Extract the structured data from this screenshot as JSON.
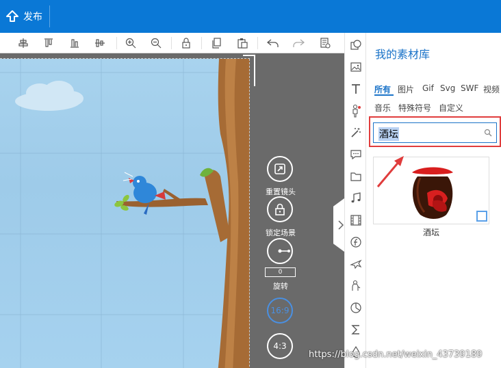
{
  "topbar": {
    "publish_label": "发布"
  },
  "toolbar": {
    "icons": [
      "align-center-icon",
      "align-top-icon",
      "align-bottom-icon",
      "align-middle-icon",
      "zoom-in-icon",
      "zoom-out-icon",
      "lock-icon",
      "copy-icon",
      "paste-icon",
      "undo-icon",
      "redo-icon",
      "properties-icon"
    ]
  },
  "camera": {
    "reset_label": "重置镜头",
    "lock_label": "锁定场景",
    "rotate_label": "旋转",
    "rotate_value": "0",
    "ratio_169": "16:9",
    "ratio_43": "4:3"
  },
  "sidebar_icons": [
    "shape-icon",
    "image-icon",
    "text-icon",
    "character-icon",
    "magic-wand-icon",
    "comment-icon",
    "folder-icon",
    "music-icon",
    "film-icon",
    "flash-icon",
    "airplane-icon",
    "mascot-icon",
    "pie-chart-icon",
    "sigma-icon",
    "drop-icon"
  ],
  "panel": {
    "title": "我的素材库",
    "tabs_row1": [
      "所有",
      "图片",
      "Gif",
      "Svg",
      "SWF",
      "视频"
    ],
    "tabs_row2": [
      "音乐",
      "特殊符号",
      "自定义"
    ],
    "active_tab": "所有",
    "search_value": "酒坛",
    "results": [
      {
        "name": "酒坛"
      }
    ]
  },
  "watermark": "https://blog.csdn.net/weixin_43739189",
  "colors": {
    "brand": "#0a78d6",
    "accent": "#1a73c8",
    "highlight": "#e03c3c"
  }
}
